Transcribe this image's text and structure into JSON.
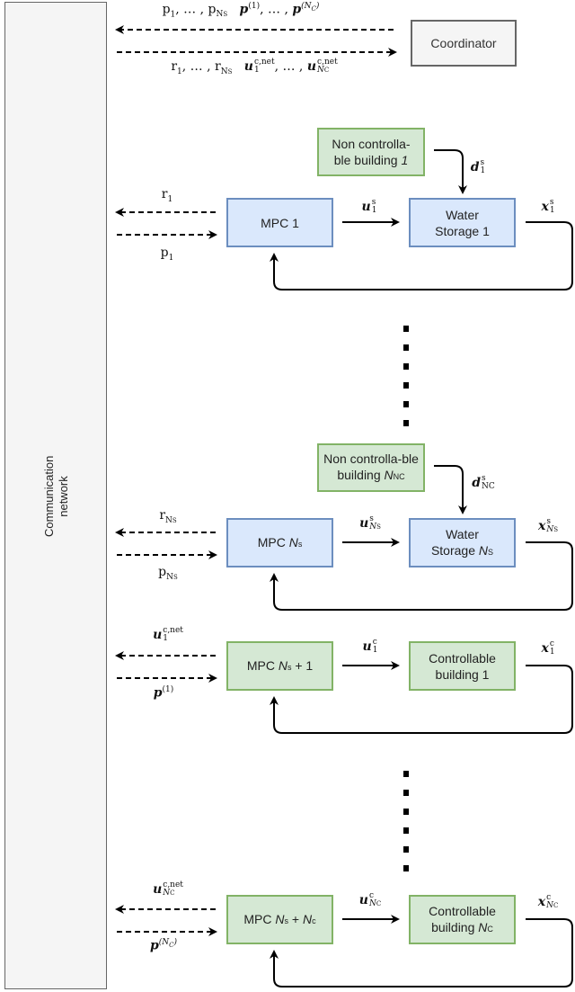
{
  "network_label": "Communication network",
  "coordinator": "Coordinator",
  "colors": {
    "storage_fill": "#dae8fc",
    "storage_stroke": "#6c8ebf",
    "building_fill": "#d5e8d4",
    "building_stroke": "#82b366",
    "neutral_fill": "#f5f5f5",
    "neutral_stroke": "#666666"
  },
  "blocks": {
    "nc1": {
      "text": "Non controlla-ble building ",
      "n": "1"
    },
    "mpc1": "MPC 1",
    "ws1": "Water Storage 1",
    "ncN": {
      "text": "Non controlla-ble building ",
      "n": "N",
      "sub": "NC"
    },
    "mpcNs": {
      "text": "MPC ",
      "n": "N",
      "sub": "s"
    },
    "wsNs": {
      "text": "Water Storage ",
      "n": "N",
      "sub": "S"
    },
    "mpcNs1": {
      "text": "MPC ",
      "n": "N",
      "sub": "s",
      "tail": " + 1"
    },
    "cb1": "Controllable building 1",
    "mpcNsNc": {
      "text": "MPC ",
      "n": "N",
      "sub": "s",
      "tail": " + ",
      "n2": "N",
      "sub2": "c"
    },
    "cbNc": {
      "text": "Controllable building ",
      "n": "N",
      "sub": "C"
    }
  },
  "dots": "⋮",
  "labels": {
    "top_up": [
      {
        "t": "p",
        "sub": "1"
      },
      {
        "t": ", … , "
      },
      {
        "t": "p",
        "sub": "N",
        "subsub": "S"
      },
      {
        "t": "   "
      },
      {
        "t": "p",
        "it": true,
        "sup": "(1)"
      },
      {
        "t": ", … , "
      },
      {
        "t": "p",
        "it": true,
        "sup": "(N",
        "supsub": "C",
        "supend": ")"
      }
    ],
    "top_down": [
      {
        "t": "r",
        "sub": "1"
      },
      {
        "t": ", … , "
      },
      {
        "t": "r",
        "sub": "N",
        "subsub": "S"
      },
      {
        "t": "   "
      },
      {
        "t": "u",
        "it": true,
        "sup": "c,net",
        "sub": "1"
      },
      {
        "t": ", … , "
      },
      {
        "t": "u",
        "it": true,
        "sup": "c,net",
        "sub": "N",
        "subsub": "C"
      }
    ],
    "r1": [
      {
        "t": "r",
        "sub": "1"
      }
    ],
    "p1": [
      {
        "t": "p",
        "sub": "1"
      }
    ],
    "us1": [
      {
        "t": "u",
        "it": true,
        "sup": "s",
        "sub": "1"
      }
    ],
    "ds1": [
      {
        "t": "d",
        "it": true,
        "sup": "s",
        "sub": "1"
      }
    ],
    "xs1": [
      {
        "t": "x",
        "it": true,
        "sup": "s",
        "sub": "1"
      }
    ],
    "rNs": [
      {
        "t": "r",
        "sub": "N",
        "subsub": "S"
      }
    ],
    "pNs": [
      {
        "t": "p",
        "sub": "N",
        "subsub": "S"
      }
    ],
    "usNs": [
      {
        "t": "u",
        "it": true,
        "sup": "s",
        "sub": "N",
        "subsub": "S"
      }
    ],
    "dsNC": [
      {
        "t": "d",
        "it": true,
        "sup": "s",
        "sub": "NC"
      }
    ],
    "xsNs": [
      {
        "t": "x",
        "it": true,
        "sup": "s",
        "sub": "N",
        "subsub": "S"
      }
    ],
    "ucnet1": [
      {
        "t": "u",
        "it": true,
        "sup": "c,net",
        "sub": "1"
      }
    ],
    "pp1": [
      {
        "t": "p",
        "it": true,
        "sup": "(1)"
      }
    ],
    "uc1": [
      {
        "t": "u",
        "it": true,
        "sup": "c",
        "sub": "1"
      }
    ],
    "xc1": [
      {
        "t": "x",
        "it": true,
        "sup": "c",
        "sub": "1"
      }
    ],
    "ucnetNc": [
      {
        "t": "u",
        "it": true,
        "sup": "c,net",
        "sub": "N",
        "subsub": "C"
      }
    ],
    "ppNc": [
      {
        "t": "p",
        "it": true,
        "sup": "(N",
        "supsub": "C",
        "supend": ")"
      }
    ],
    "ucNc": [
      {
        "t": "u",
        "it": true,
        "sup": "c",
        "sub": "N",
        "subsub": "C"
      }
    ],
    "xcNc": [
      {
        "t": "x",
        "it": true,
        "sup": "c",
        "sub": "N",
        "subsub": "C"
      }
    ]
  }
}
